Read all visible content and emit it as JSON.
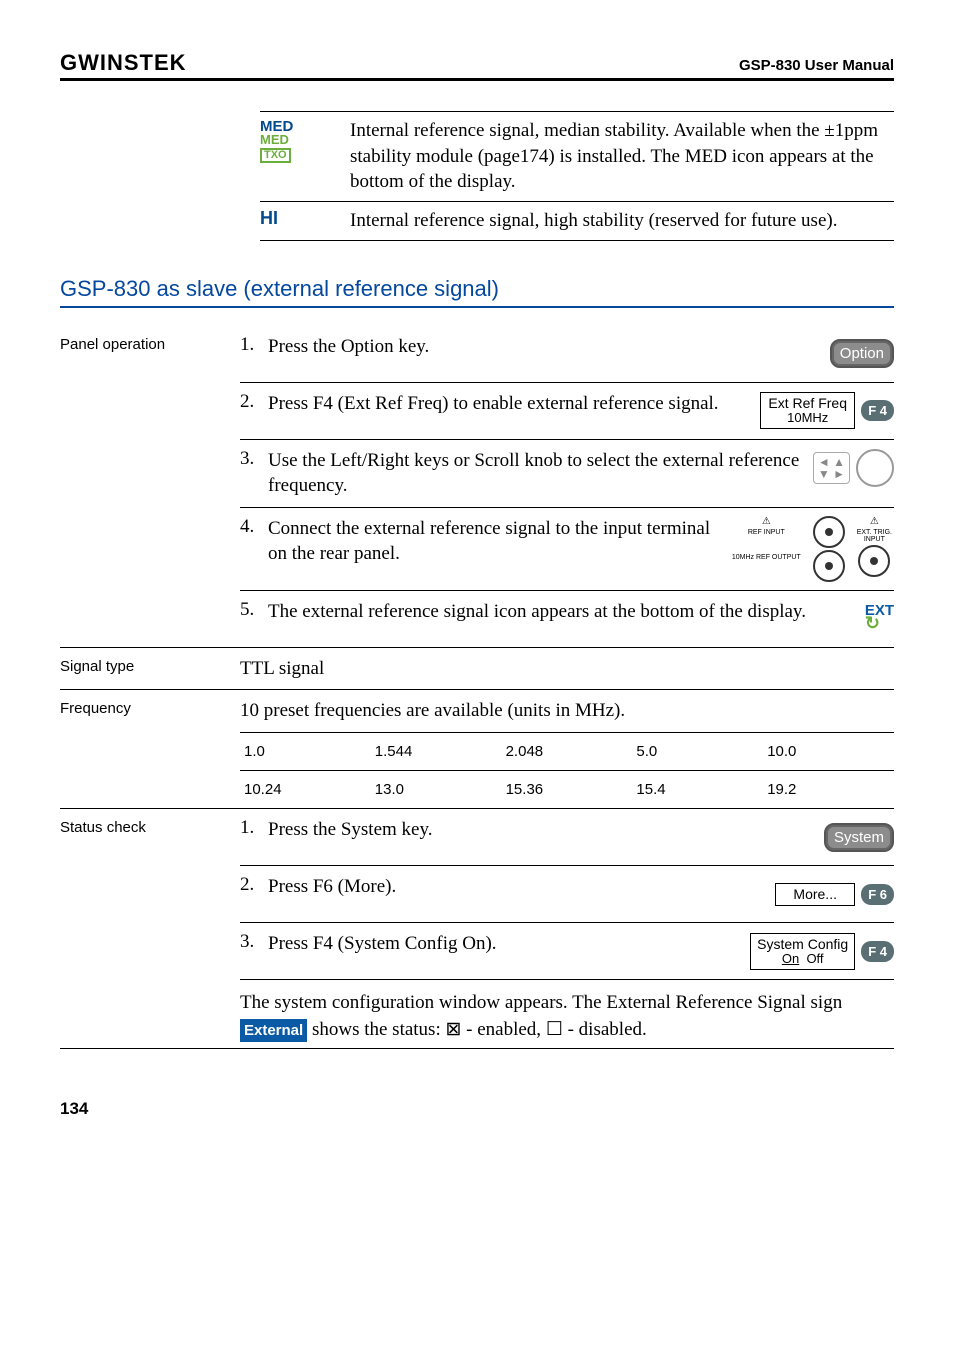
{
  "header": {
    "brand": "GWINSTEK",
    "title": "GSP-830 User Manual"
  },
  "topTable": {
    "row1": {
      "iconTop": "MED",
      "iconMid": "MED",
      "iconBox": "TXO",
      "text": "Internal reference signal, median stability. Available when the ±1ppm stability module (page174) is installed. The MED icon appears at the bottom of the display."
    },
    "row2": {
      "icon": "HI",
      "text": "Internal reference signal, high stability (reserved for future use)."
    }
  },
  "sectionTitle": "GSP-830 as slave (external reference signal)",
  "panelOp": {
    "label": "Panel operation",
    "step1": {
      "n": "1.",
      "t": "Press the Option key.",
      "btn": "Option"
    },
    "step2": {
      "n": "2.",
      "t": "Press F4 (Ext Ref Freq) to enable external reference signal.",
      "soft_l1": "Ext Ref Freq",
      "soft_l2": "10MHz",
      "fkey": "F 4"
    },
    "step3": {
      "n": "3.",
      "t": "Use the Left/Right keys or Scroll knob to select the external reference frequency."
    },
    "step4": {
      "n": "4.",
      "t": "Connect the external reference signal to the input terminal on the rear panel.",
      "labels": {
        "warn": "⚠",
        "refin": "REF INPUT",
        "exttrig": "EXT. TRIG.\nINPUT",
        "refout": "10MHz\nREF OUTPUT"
      }
    },
    "step5": {
      "n": "5.",
      "t": "The external reference signal icon appears at the bottom of the display.",
      "iconTop": "EXT",
      "iconArrow": "↻"
    }
  },
  "signalType": {
    "label": "Signal type",
    "value": "TTL signal"
  },
  "frequency": {
    "label": "Frequency",
    "intro": "10 preset frequencies are available (units in MHz).",
    "row1": [
      "1.0",
      "1.544",
      "2.048",
      "5.0",
      "10.0"
    ],
    "row2": [
      "10.24",
      "13.0",
      "15.36",
      "15.4",
      "19.2"
    ]
  },
  "statusCheck": {
    "label": "Status check",
    "step1": {
      "n": "1.",
      "t": "Press the System key.",
      "btn": "System"
    },
    "step2": {
      "n": "2.",
      "t": "Press F6 (More).",
      "soft": "More...",
      "fkey": "F 6"
    },
    "step3": {
      "n": "3.",
      "t": "Press F4 (System Config On).",
      "soft_l1": "System Config",
      "soft_on": "On",
      "soft_off": "Off",
      "fkey": "F 4"
    },
    "para_a": "The system configuration window appears. The External Reference Signal sign ",
    "para_badge": "External",
    "para_b": " shows the status: ",
    "enabled_sym": "⊠",
    "enabled_txt": " - enabled, ",
    "disabled_sym": "☐",
    "disabled_txt": " - disabled."
  },
  "pageNumber": "134"
}
